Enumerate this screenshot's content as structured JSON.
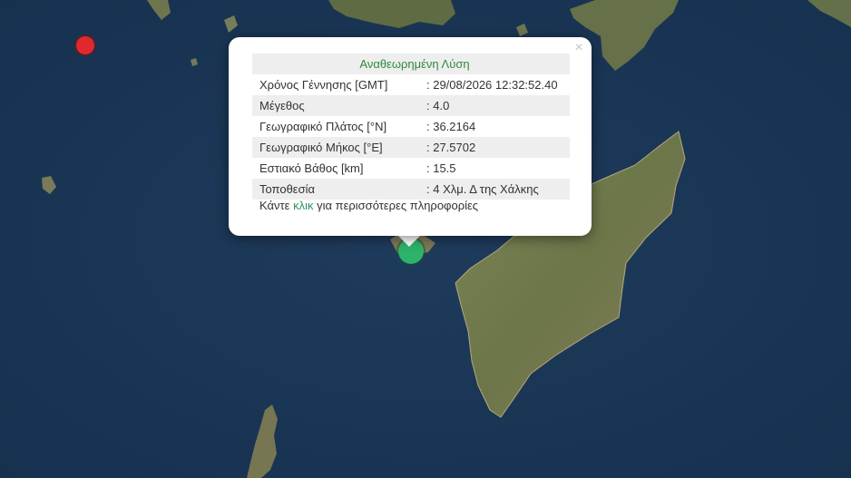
{
  "popup": {
    "title": "Αναθεωρημένη Λύση",
    "close_symbol": "×",
    "rows": [
      {
        "label": "Χρόνος Γέννησης [GMT]",
        "value": ": 29/08/2026 12:32:52.40"
      },
      {
        "label": "Μέγεθος",
        "value": ": 4.0"
      },
      {
        "label": "Γεωγραφικό Πλάτος [°N]",
        "value": ": 36.2164"
      },
      {
        "label": "Γεωγραφικό Μήκος [°E]",
        "value": ": 27.5702"
      },
      {
        "label": "Εστιακό Βάθος [km]",
        "value": ": 15.5"
      },
      {
        "label": "Τοποθεσία",
        "value": ": 4 Χλμ. Δ της Χάλκης"
      }
    ],
    "more_before": "Κάντε ",
    "more_link": "κλικ",
    "more_after": " για περισσότερες πληροφορίες"
  },
  "markers": [
    {
      "name": "red-earthquake-marker",
      "color": "#e0282e"
    },
    {
      "name": "green-earthquake-marker",
      "color": "#2db36b"
    }
  ],
  "colors": {
    "sea": "#1b3553",
    "land": "#6b7649",
    "title": "#2e8b3e",
    "link": "#2f8f5e"
  }
}
